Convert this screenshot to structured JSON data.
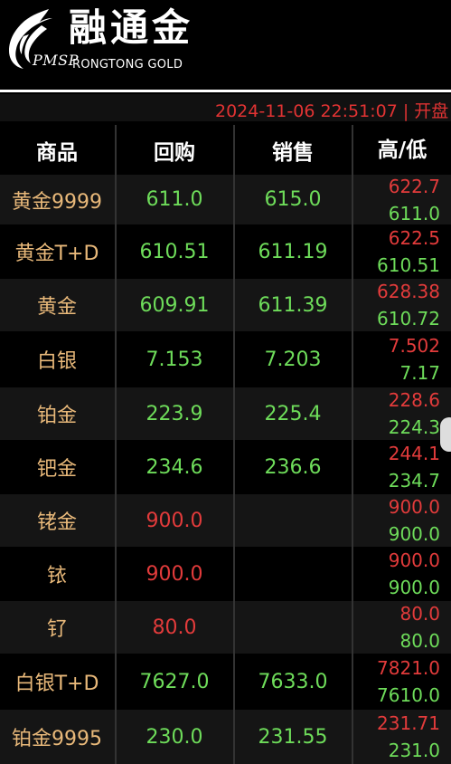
{
  "header": {
    "logo_mark_text": "PMSP",
    "brand_cn": "融通金",
    "brand_en": "RONGTONG GOLD"
  },
  "ticker": {
    "text": "2024-11-06 22:51:07 | 开盘"
  },
  "table": {
    "columns": [
      "商品",
      "回购",
      "销售",
      "高/低"
    ],
    "rows": [
      {
        "name": "黄金9999",
        "buy": "611.0",
        "sell": "615.0",
        "high": "622.7",
        "low": "611.0",
        "buy_color": "green"
      },
      {
        "name": "黄金T+D",
        "buy": "610.51",
        "sell": "611.19",
        "high": "622.5",
        "low": "610.51",
        "buy_color": "green"
      },
      {
        "name": "黄金",
        "buy": "609.91",
        "sell": "611.39",
        "high": "628.38",
        "low": "610.72",
        "buy_color": "green"
      },
      {
        "name": "白银",
        "buy": "7.153",
        "sell": "7.203",
        "high": "7.502",
        "low": "7.17",
        "buy_color": "green"
      },
      {
        "name": "铂金",
        "buy": "223.9",
        "sell": "225.4",
        "high": "228.6",
        "low": "224.3",
        "buy_color": "green"
      },
      {
        "name": "钯金",
        "buy": "234.6",
        "sell": "236.6",
        "high": "244.1",
        "low": "234.7",
        "buy_color": "green"
      },
      {
        "name": "铑金",
        "buy": "900.0",
        "sell": "",
        "high": "900.0",
        "low": "900.0",
        "buy_color": "red"
      },
      {
        "name": "铱",
        "buy": "900.0",
        "sell": "",
        "high": "900.0",
        "low": "900.0",
        "buy_color": "red"
      },
      {
        "name": "钌",
        "buy": "80.0",
        "sell": "",
        "high": "80.0",
        "low": "80.0",
        "buy_color": "red"
      },
      {
        "name": "白银T+D",
        "buy": "7627.0",
        "sell": "7633.0",
        "high": "7821.0",
        "low": "7610.0",
        "buy_color": "green"
      },
      {
        "name": "铂金9995",
        "buy": "230.0",
        "sell": "231.55",
        "high": "231.71",
        "low": "231.0",
        "buy_color": "green"
      }
    ]
  },
  "colors": {
    "background": "#000000",
    "up": "#e23b3b",
    "down": "#6edc5a",
    "name": "#e9b97a"
  }
}
